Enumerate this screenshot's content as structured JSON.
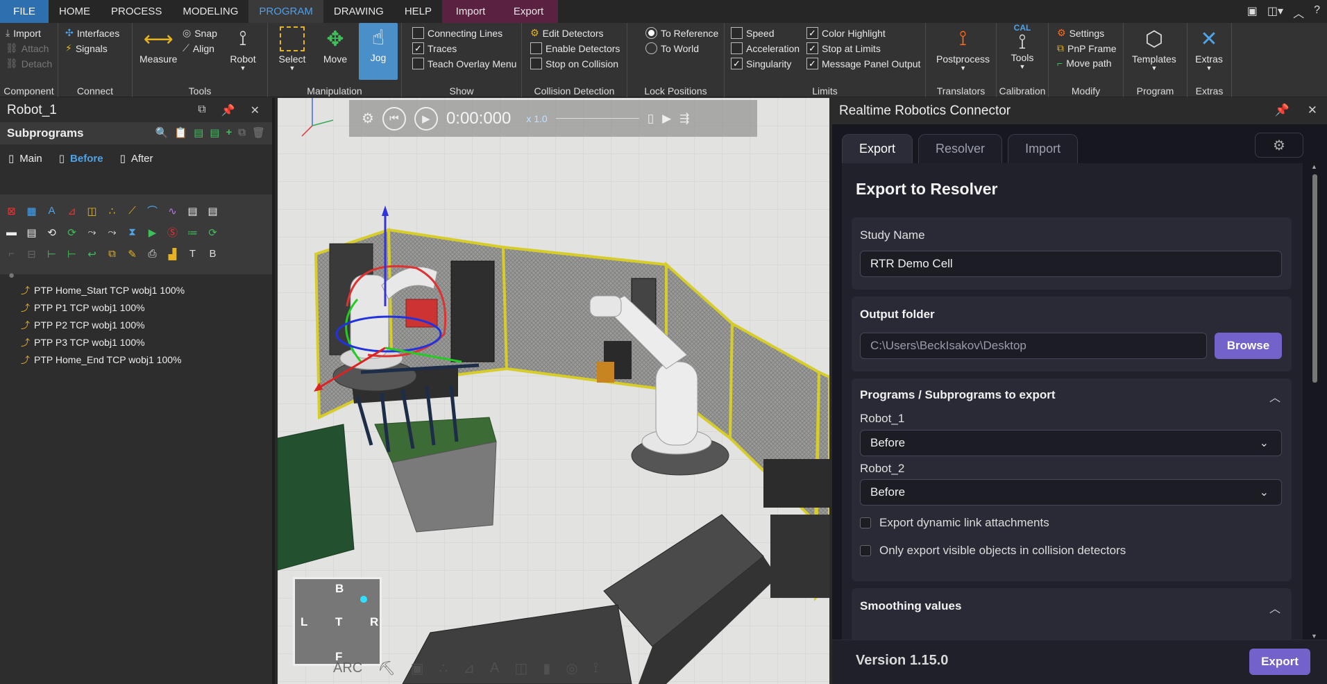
{
  "menu": {
    "tabs": [
      "FILE",
      "HOME",
      "PROCESS",
      "MODELING",
      "PROGRAM",
      "DRAWING",
      "HELP",
      "Import",
      "Export"
    ],
    "active": "PROGRAM"
  },
  "ribbon": {
    "component": {
      "label": "Component",
      "import": "Import",
      "attach": "Attach",
      "detach": "Detach"
    },
    "connect": {
      "label": "Connect",
      "interfaces": "Interfaces",
      "signals": "Signals"
    },
    "tools": {
      "label": "Tools",
      "measure": "Measure",
      "snap": "Snap",
      "align": "Align",
      "robot": "Robot"
    },
    "manipulation": {
      "label": "Manipulation",
      "select": "Select",
      "move": "Move",
      "jog": "Jog"
    },
    "show": {
      "label": "Show",
      "connecting_lines": "Connecting Lines",
      "traces": "Traces",
      "teach_overlay": "Teach Overlay Menu"
    },
    "collision": {
      "label": "Collision Detection",
      "edit": "Edit Detectors",
      "enable": "Enable Detectors",
      "stop": "Stop on Collision"
    },
    "lock": {
      "label": "Lock Positions",
      "to_reference": "To Reference",
      "to_world": "To World"
    },
    "limits": {
      "label": "Limits",
      "speed": "Speed",
      "acceleration": "Acceleration",
      "singularity": "Singularity",
      "color_highlight": "Color Highlight",
      "stop_at_limits": "Stop at Limits",
      "message_panel": "Message Panel Output"
    },
    "translators": {
      "label": "Translators",
      "postprocess": "Postprocess"
    },
    "calibration": {
      "label": "Calibration",
      "tools": "Tools",
      "cal": "CAL"
    },
    "modify": {
      "label": "Modify",
      "settings": "Settings",
      "pnp": "PnP Frame",
      "move_path": "Move path"
    },
    "program": {
      "label": "Program",
      "templates": "Templates"
    },
    "extras": {
      "label": "Extras",
      "extras": "Extras"
    }
  },
  "left_panel": {
    "title": "Robot_1",
    "subprograms_label": "Subprograms",
    "subtabs": [
      "Main",
      "Before",
      "After"
    ],
    "active_subtab": "Before",
    "commands": [
      "PTP Home_Start TCP wobj1 100%",
      "PTP P1 TCP wobj1 100%",
      "PTP P2 TCP wobj1 100%",
      "PTP P3 TCP wobj1 100%",
      "PTP Home_End TCP wobj1 100%"
    ]
  },
  "viewport": {
    "time": "0:00:000",
    "speed": "x 1.0",
    "cube": {
      "top": "B",
      "left": "L",
      "center": "T",
      "right": "R",
      "bottom": "F"
    },
    "bottom_label": "ARC"
  },
  "right_panel": {
    "title": "Realtime Robotics Connector",
    "tabs": [
      "Export",
      "Resolver",
      "Import"
    ],
    "active_tab": "Export",
    "heading": "Export to Resolver",
    "study_name_label": "Study Name",
    "study_name_value": "RTR Demo Cell",
    "output_folder_label": "Output folder",
    "output_folder_value": "C:\\Users\\BeckIsakov\\Desktop",
    "browse_label": "Browse",
    "programs_label": "Programs / Subprograms to export",
    "robot1_label": "Robot_1",
    "robot1_value": "Before",
    "robot2_label": "Robot_2",
    "robot2_value": "Before",
    "chk_dynamic": "Export dynamic link attachments",
    "chk_visible": "Only export visible objects in collision detectors",
    "smoothing_label": "Smoothing values",
    "version": "Version 1.15.0",
    "export_button": "Export"
  },
  "colors": {
    "accent": "#7262c9",
    "program_tab": "#4ea0ea",
    "file_tab": "#2e6fb0",
    "import_export_tabs": "#5a2141"
  }
}
